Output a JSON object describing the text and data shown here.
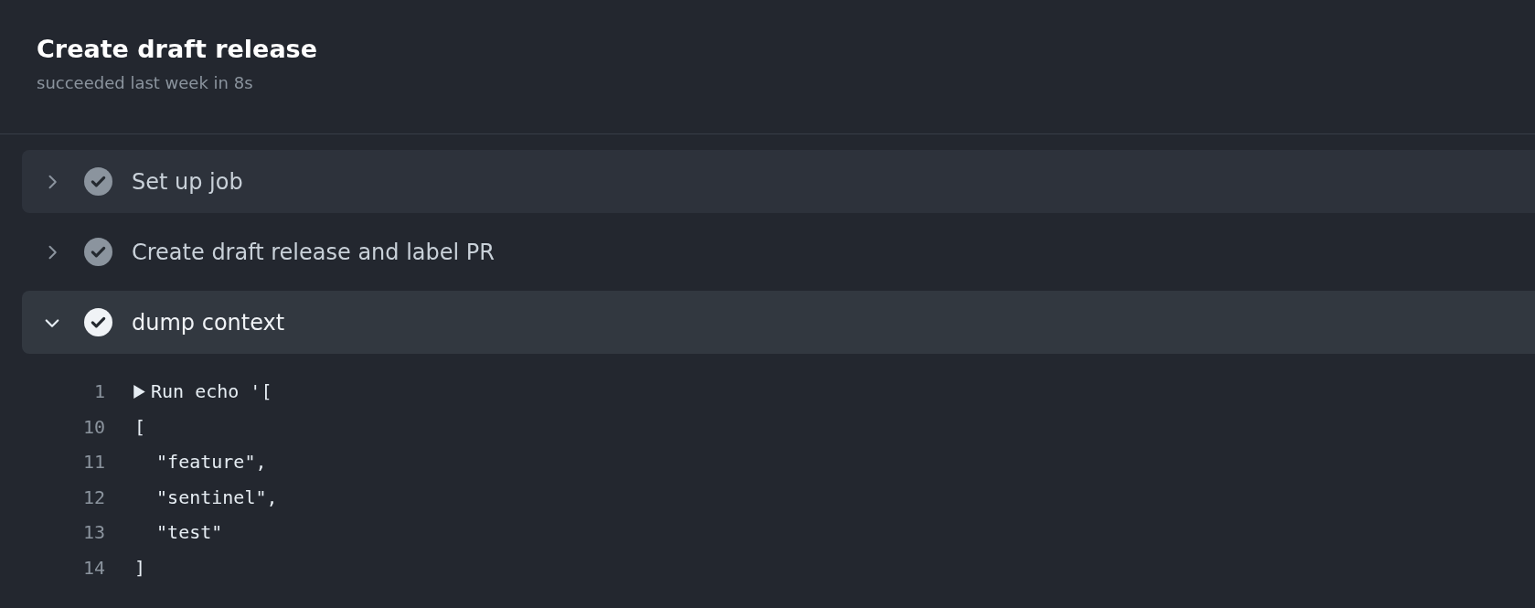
{
  "job": {
    "title": "Create draft release",
    "status": "succeeded last week in 8s"
  },
  "steps": [
    {
      "name": "Set up job",
      "expanded": false,
      "highlighted": true
    },
    {
      "name": "Create draft release and label PR",
      "expanded": false,
      "highlighted": false
    },
    {
      "name": "dump context",
      "expanded": true,
      "highlighted": true,
      "log": [
        {
          "number": "1",
          "kind": "group",
          "text": "Run echo '["
        },
        {
          "number": "10",
          "kind": "line",
          "text": "["
        },
        {
          "number": "11",
          "kind": "line",
          "text": "  \"feature\","
        },
        {
          "number": "12",
          "kind": "line",
          "text": "  \"sentinel\","
        },
        {
          "number": "13",
          "kind": "line",
          "text": "  \"test\""
        },
        {
          "number": "14",
          "kind": "line",
          "text": "]"
        }
      ]
    }
  ]
}
